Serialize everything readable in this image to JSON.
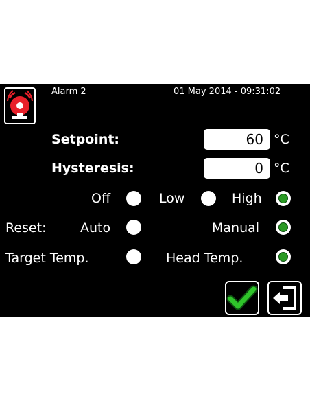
{
  "header": {
    "icon": "alarm-bell-icon",
    "title": "Alarm 2",
    "datetime": "01 May 2014 - 09:31:02"
  },
  "setpoint": {
    "label": "Setpoint:",
    "value": "60",
    "unit": "°C"
  },
  "hysteresis": {
    "label": "Hysteresis:",
    "value": "0",
    "unit": "°C"
  },
  "level": {
    "options": [
      "Off",
      "Low",
      "High"
    ],
    "selected": "High"
  },
  "reset": {
    "label": "Reset:",
    "options": [
      "Auto",
      "Manual"
    ],
    "selected": "Manual"
  },
  "temp_source": {
    "options": [
      "Target Temp.",
      "Head Temp."
    ],
    "selected": "Head Temp."
  },
  "buttons": {
    "confirm_icon": "checkmark-icon",
    "exit_icon": "exit-icon"
  },
  "colors": {
    "accent": "#2a9a24",
    "alarm_red": "#e8202a"
  }
}
